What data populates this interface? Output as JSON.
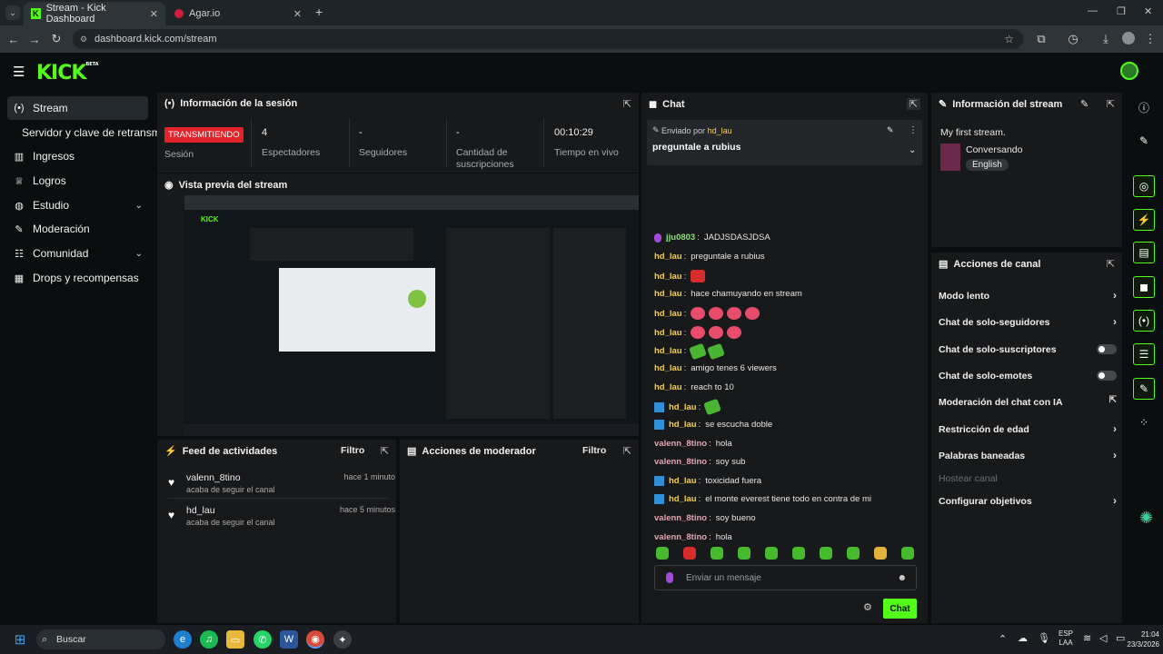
{
  "browser": {
    "tabs": [
      {
        "title": "Stream - Kick Dashboard",
        "active": true
      },
      {
        "title": "Agar.io",
        "active": false
      }
    ],
    "url": "dashboard.kick.com/stream"
  },
  "app": {
    "logo": "KICK",
    "logo_tag": "BETA",
    "brand_color": "#53fc18"
  },
  "sidebar": {
    "items": [
      {
        "label": "Stream",
        "icon": "broadcast-icon"
      },
      {
        "label": "Servidor y clave de retransmi",
        "icon": ""
      },
      {
        "label": "Ingresos",
        "icon": "chart-icon"
      },
      {
        "label": "Logros",
        "icon": "trophy-icon"
      },
      {
        "label": "Estudio",
        "icon": "palette-icon"
      },
      {
        "label": "Moderación",
        "icon": "wrench-icon"
      },
      {
        "label": "Comunidad",
        "icon": "people-icon"
      },
      {
        "label": "Drops y recompensas",
        "icon": "gift-icon"
      }
    ]
  },
  "session": {
    "title": "Información de la sesión",
    "live_badge": "TRANSMITIENDO",
    "session_label": "Sesión",
    "stats": [
      {
        "value": "4",
        "label": "Espectadores"
      },
      {
        "value": "-",
        "label": "Seguidores"
      },
      {
        "value": "-",
        "label": "Cantidad de suscripciones"
      },
      {
        "value": "00:10:29",
        "label": "Tiempo en vivo"
      }
    ]
  },
  "preview": {
    "title": "Vista previa del stream"
  },
  "activity": {
    "title": "Feed de actividades",
    "filter": "Filtro",
    "items": [
      {
        "name": "valenn_8tino",
        "text": "acaba de seguir el canal",
        "time": "hace 1 minuto"
      },
      {
        "name": "hd_lau",
        "text": "acaba de seguir el canal",
        "time": "hace 5 minutos"
      }
    ]
  },
  "modactions": {
    "title": "Acciones de moderador",
    "filter": "Filtro"
  },
  "chat": {
    "title": "Chat",
    "pinned_by": "Enviado por",
    "pinned_user": "hd_lau",
    "pinned_text": "preguntale a rubius",
    "messages": [
      {
        "user": "jju0803",
        "text": "JADJSDASJDSA"
      },
      {
        "user": "hd_lau",
        "text": "preguntale a rubius"
      },
      {
        "user": "hd_lau",
        "text": ""
      },
      {
        "user": "hd_lau",
        "text": "hace chamuyando en stream"
      },
      {
        "user": "hd_lau",
        "text": ""
      },
      {
        "user": "hd_lau",
        "text": ""
      },
      {
        "user": "hd_lau",
        "text": ""
      },
      {
        "user": "hd_lau",
        "text": "amigo tenes 6 viewers"
      },
      {
        "user": "hd_lau",
        "text": "reach to 10"
      },
      {
        "user": "hd_lau",
        "text": ""
      },
      {
        "user": "hd_lau",
        "text": "se escucha doble"
      },
      {
        "user": "valenn_8tino",
        "text": "hola"
      },
      {
        "user": "valenn_8tino",
        "text": "soy sub"
      },
      {
        "user": "hd_lau",
        "text": "toxicidad fuera"
      },
      {
        "user": "hd_lau",
        "text": "el monte everest tiene todo en contra de mi"
      },
      {
        "user": "valenn_8tino",
        "text": "soy bueno"
      },
      {
        "user": "valenn_8tino",
        "text": "hola"
      }
    ],
    "placeholder": "Enviar un mensaje",
    "send": "Chat"
  },
  "stream_info": {
    "title": "Información del stream",
    "stream_title": "My first stream.",
    "category": "Conversando",
    "language": "English"
  },
  "channel_actions": {
    "title": "Acciones de canal",
    "items": [
      {
        "label": "Modo lento",
        "kind": "arrow"
      },
      {
        "label": "Chat de solo-seguidores",
        "kind": "arrow"
      },
      {
        "label": "Chat de solo-suscriptores",
        "kind": "toggle"
      },
      {
        "label": "Chat de solo-emotes",
        "kind": "toggle"
      },
      {
        "label": "Moderación del chat con IA",
        "kind": "external"
      },
      {
        "label": "Restricción de edad",
        "kind": "arrow"
      },
      {
        "label": "Palabras baneadas",
        "kind": "arrow"
      },
      {
        "label": "Hostear canal",
        "kind": "disabled"
      },
      {
        "label": "Configurar objetivos",
        "kind": "arrow"
      }
    ]
  },
  "taskbar": {
    "search": "Buscar",
    "lang": "ESP",
    "lang2": "LAA",
    "time": "21:04",
    "date": "23/3/2026"
  }
}
